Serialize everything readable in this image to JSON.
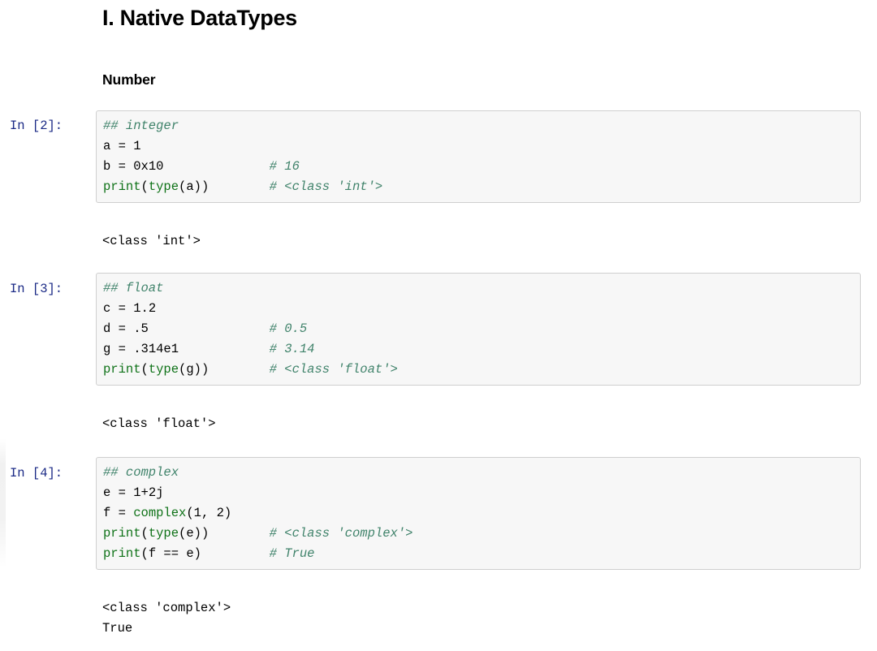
{
  "document": {
    "heading_1": "I. Native DataTypes",
    "heading_2": "Number"
  },
  "colors": {
    "prompt": "#1b2a86",
    "comment": "#40836b",
    "builtin": "#0f7218",
    "cell_background": "#f7f7f7",
    "cell_border": "#cfcfcf",
    "text": "#000000",
    "page_background": "#ffffff"
  },
  "cells": [
    {
      "prompt": "In [2]:",
      "execution_count": 2,
      "source": "## integer\na = 1\nb = 0x10              # 16\nprint(type(a))        # <class 'int'>",
      "lines": [
        {
          "comment": "## integer"
        },
        {
          "code": "a = 1"
        },
        {
          "code": "b = 0x10",
          "comment": "# 16"
        },
        {
          "code": "print(type(a))",
          "comment": "# <class 'int'>",
          "builtins": [
            "print",
            "type"
          ]
        }
      ],
      "output": "<class 'int'>"
    },
    {
      "prompt": "In [3]:",
      "execution_count": 3,
      "source": "## float\nc = 1.2\nd = .5                # 0.5\ng = .314e1            # 3.14\nprint(type(g))        # <class 'float'>",
      "lines": [
        {
          "comment": "## float"
        },
        {
          "code": "c = 1.2"
        },
        {
          "code": "d = .5",
          "comment": "# 0.5"
        },
        {
          "code": "g = .314e1",
          "comment": "# 3.14"
        },
        {
          "code": "print(type(g))",
          "comment": "# <class 'float'>",
          "builtins": [
            "print",
            "type"
          ]
        }
      ],
      "output": "<class 'float'>"
    },
    {
      "prompt": "In [4]:",
      "execution_count": 4,
      "source": "## complex\ne = 1+2j\nf = complex(1, 2)\nprint(type(e))        # <class 'complex'>\nprint(f == e)         # True",
      "lines": [
        {
          "comment": "## complex"
        },
        {
          "code": "e = 1+2j"
        },
        {
          "code": "f = complex(1, 2)",
          "builtins": [
            "complex"
          ]
        },
        {
          "code": "print(type(e))",
          "comment": "# <class 'complex'>",
          "builtins": [
            "print",
            "type"
          ]
        },
        {
          "code": "print(f == e)",
          "comment": "# True",
          "builtins": [
            "print"
          ]
        }
      ],
      "output": "<class 'complex'>\nTrue"
    }
  ]
}
